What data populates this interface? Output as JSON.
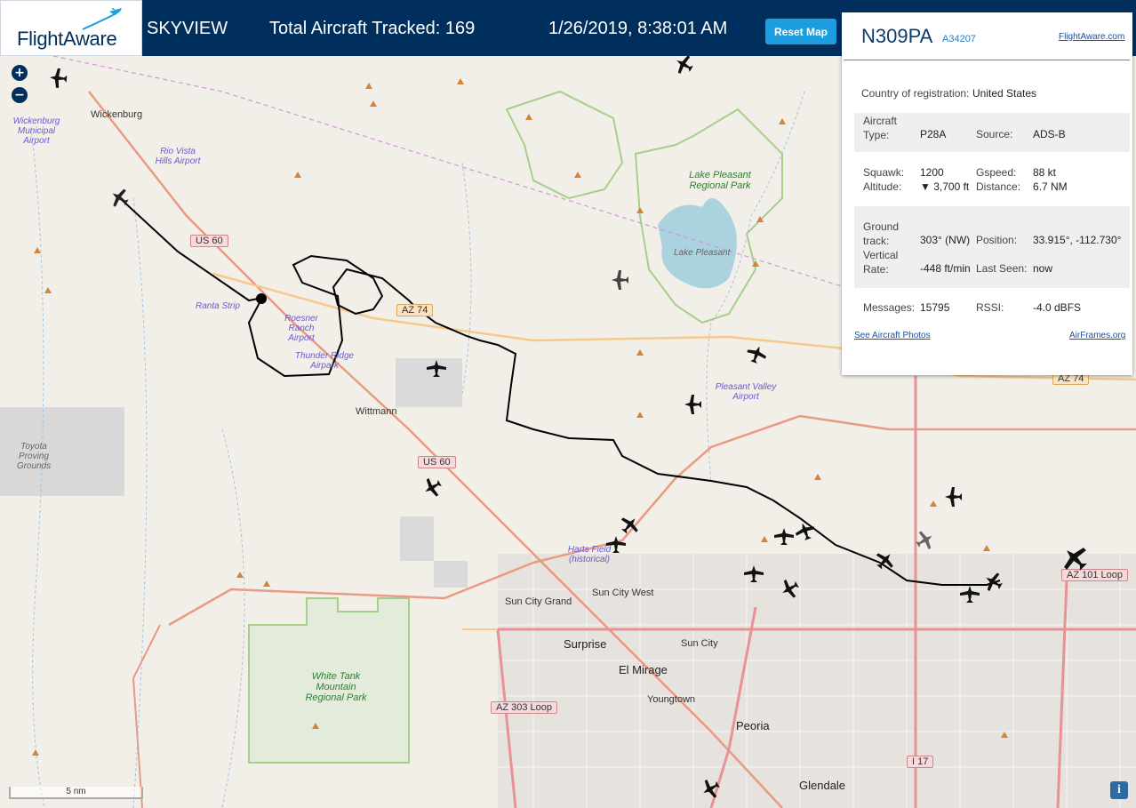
{
  "header": {
    "brand": "FlightAware",
    "app_title": "SKYVIEW",
    "tracked_label": "Total Aircraft Tracked: 169",
    "datetime": "1/26/2019, 8:38:01 AM",
    "reset_label": "Reset Map",
    "color": "#002f5d",
    "accent": "#1a9ee0"
  },
  "map": {
    "zoom_in": "+",
    "zoom_out": "−",
    "scale": "5 nm",
    "info": "i",
    "places": {
      "wickenburg": "Wickenburg",
      "wittmann": "Wittmann",
      "surprise": "Surprise",
      "el_mirage": "El Mirage",
      "sun_city": "Sun City",
      "sun_city_west": "Sun City West",
      "sun_city_grand": "Sun City Grand",
      "youngtown": "Youngtown",
      "peoria": "Peoria",
      "glendale": "Glendale",
      "lake_pleasant": "Lake Pleasant"
    },
    "parks": {
      "lake_pleasant_park": "Lake Pleasant Regional Park",
      "white_tank": "White Tank Mountain Regional Park"
    },
    "airports": {
      "wickenburg_muni": "Wickenburg Municipal Airport",
      "rio_vista": "Rio Vista Hills Airport",
      "ranta": "Ranta Strip",
      "rosesner": "Roesner Ranch Airport",
      "thunder_ridge": "Thunder Ridge Airpark",
      "pleasant_valley": "Pleasant Valley Airport",
      "harts": "Harts Field (historical)",
      "toyota": "Toyota Proving Grounds"
    },
    "shields": {
      "us60_a": "US 60",
      "us60_b": "US 60",
      "az74_a": "AZ 74",
      "az74_b": "AZ 74",
      "az303": "AZ 303 Loop",
      "az101": "AZ 101 Loop",
      "i17": "I 17"
    }
  },
  "panel": {
    "callsign": "N309PA",
    "hex": "A34207",
    "fa_link": "FlightAware.com",
    "country_label": "Country of registration:",
    "country": "United States",
    "type_label": "Aircraft Type:",
    "type": "P28A",
    "source_label": "Source:",
    "source": "ADS-B",
    "squawk_label": "Squawk:",
    "squawk": "1200",
    "gspeed_label": "Gspeed:",
    "gspeed": "88 kt",
    "altitude_label": "Altitude:",
    "altitude": "▼ 3,700 ft",
    "distance_label": "Distance:",
    "distance": "6.7 NM",
    "track_label": "Ground track:",
    "track": "303° (NW)",
    "position_label": "Position:",
    "position": "33.915°, -112.730°",
    "vrate_label": "Vertical Rate:",
    "vrate": "-448 ft/min",
    "lastseen_label": "Last Seen:",
    "lastseen": "now",
    "messages_label": "Messages:",
    "messages": "15795",
    "rssi_label": "RSSI:",
    "rssi": "-4.0 dBFS",
    "photos_link": "See Aircraft Photos",
    "airframes_link": "AirFrames.org"
  }
}
